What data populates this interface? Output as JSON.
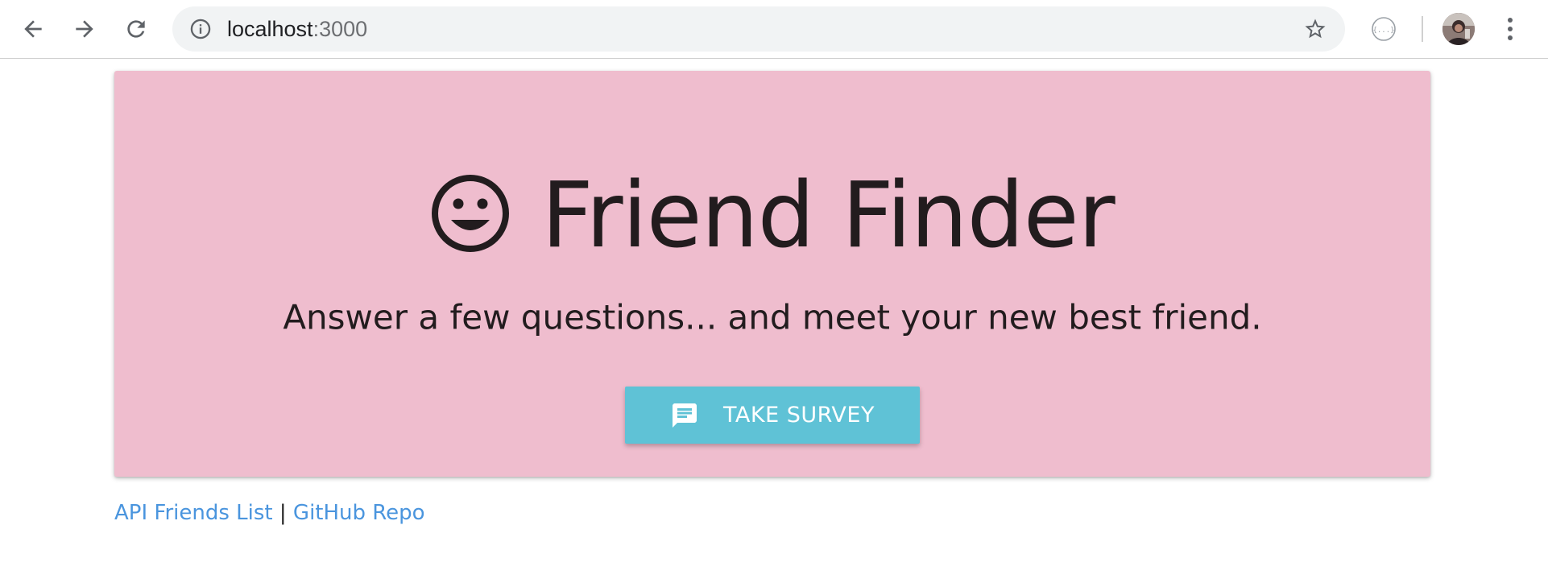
{
  "browser": {
    "url_host": "localhost",
    "url_port": ":3000",
    "icons": {
      "back": "arrow-left-icon",
      "forward": "arrow-right-icon",
      "reload": "reload-icon",
      "info": "info-icon",
      "bookmark": "star-icon",
      "extension": "json-extension-icon",
      "profile": "avatar",
      "menu": "more-vert-icon"
    }
  },
  "hero": {
    "icon": "smiley-face-icon",
    "title": "Friend Finder",
    "subtitle": "Answer a few questions... and meet your new best friend.",
    "button": {
      "icon": "chat-bubble-icon",
      "label": "TAKE SURVEY"
    }
  },
  "footer": {
    "link_api": "API Friends List",
    "separator": "|",
    "link_github": "GitHub Repo"
  },
  "colors": {
    "jumbotron_bg": "#efbdce",
    "button_bg": "#5fc2d6",
    "link": "#4a95de",
    "text": "#221c1e"
  }
}
